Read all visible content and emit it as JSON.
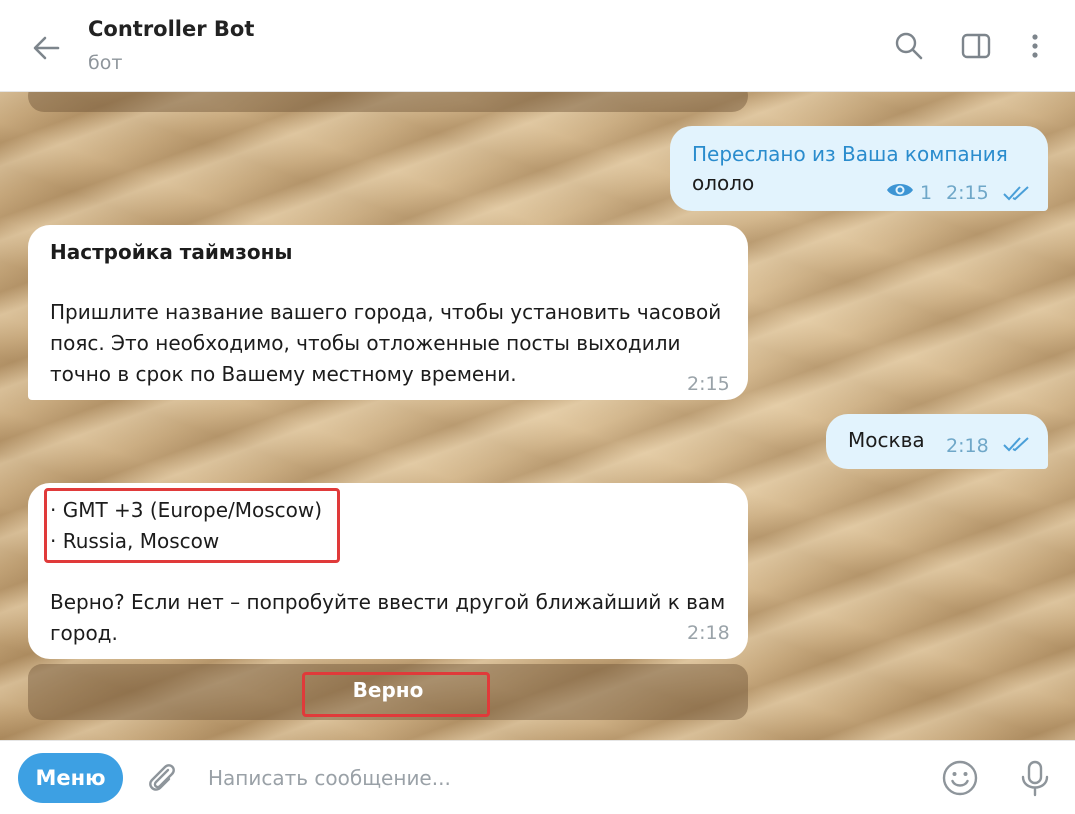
{
  "header": {
    "title": "Controller Bot",
    "subtitle": "бот"
  },
  "messages": {
    "forwarded": {
      "label": "Переслано из Ваша компания",
      "text": "ололо",
      "views": "1",
      "time": "2:15"
    },
    "timezone": {
      "heading": "Настройка таймзоны",
      "line1": "Пришлите название вашего города, чтобы установить часовой",
      "line2": "пояс. Это необходимо, чтобы отложенные посты выходили",
      "line3": "точно в срок по Вашему местному времени.",
      "time": "2:15"
    },
    "city": {
      "text": "Москва",
      "time": "2:18"
    },
    "result": {
      "tz_line": "· GMT +3 (Europe/Moscow)",
      "city_line": "· Russia, Moscow",
      "q_line1": "Верно? Если нет – попробуйте ввести другой ближайший к вам",
      "q_line2": "город.",
      "time": "2:18"
    }
  },
  "keyboard": {
    "button_label": "Верно"
  },
  "composer": {
    "menu_label": "Меню",
    "placeholder": "Написать сообщение..."
  },
  "colors": {
    "accent": "#3da0e3",
    "link": "#2a8ccd",
    "outgoing_bubble": "#e2f3fd",
    "highlight": "#e03a3a"
  }
}
